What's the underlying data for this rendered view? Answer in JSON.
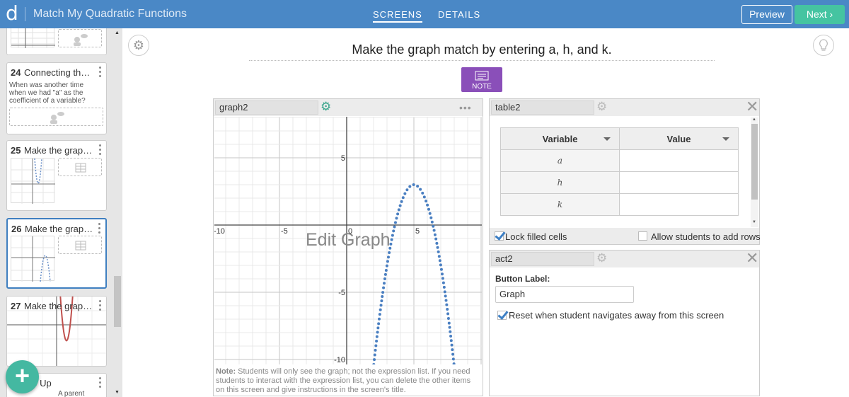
{
  "header": {
    "logo": "d",
    "title": "Match My Quadratic Functions",
    "tabs": [
      {
        "label": "SCREENS",
        "active": true
      },
      {
        "label": "DETAILS",
        "active": false
      }
    ],
    "preview_label": "Preview",
    "next_label": "Next ›",
    "colors": {
      "bar": "#4a88c6",
      "next": "#45c4a1"
    }
  },
  "sidebar": {
    "cards": [
      {
        "num": "24",
        "title": "Connecting th…",
        "desc": "When was another time when we had \"a\" as the coefficient of a variable?"
      },
      {
        "num": "25",
        "title": "Make the grap…"
      },
      {
        "num": "26",
        "title": "Make the grap…",
        "selected": true
      },
      {
        "num": "27",
        "title": "Make the grap…"
      },
      {
        "title": "ap Up",
        "desc": "A parent"
      }
    ],
    "add_icon": "+"
  },
  "screen": {
    "title": "Make the graph match by entering a, h, and k.",
    "note_label": "NOTE"
  },
  "graph": {
    "name": "graph2",
    "overlay_text": "Edit Graph",
    "x_ticks": [
      "-10",
      "-5",
      "0",
      "5"
    ],
    "y_ticks": [
      "5",
      "-5",
      "-10"
    ],
    "note_bold": "Note:",
    "note_text": " Students will only see the graph; not the expression list. If you need students to interact with the expression list, you can delete the other items on this screen and give instructions in the screen's title.",
    "curve": {
      "vertex": [
        5,
        3
      ],
      "a": -1.5,
      "color": "#4a7fc1",
      "style": "dotted"
    }
  },
  "table": {
    "name": "table2",
    "headers": [
      "Variable",
      "Value"
    ],
    "rows": [
      [
        "a",
        ""
      ],
      [
        "h",
        ""
      ],
      [
        "k",
        ""
      ]
    ],
    "lock_label": "Lock filled cells",
    "lock_checked": true,
    "allow_rows_label": "Allow students to add rows",
    "allow_rows_checked": false
  },
  "action": {
    "name": "act2",
    "button_label_heading": "Button Label:",
    "button_label_value": "Graph",
    "reset_label": "Reset when student navigates away from this screen",
    "reset_checked": true
  }
}
